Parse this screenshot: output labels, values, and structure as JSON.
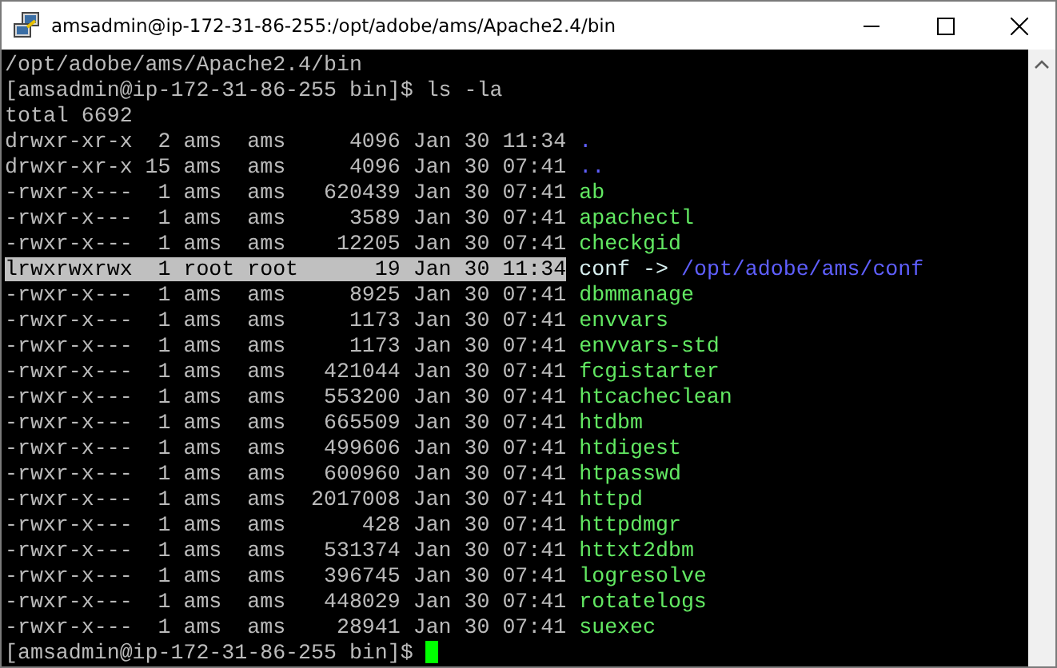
{
  "window": {
    "title": "amsadmin@ip-172-31-86-255:/opt/adobe/ams/Apache2.4/bin"
  },
  "terminal": {
    "lines": [
      {
        "kind": "text",
        "text": "/opt/adobe/ams/Apache2.4/bin"
      },
      {
        "kind": "text",
        "text": "[amsadmin@ip-172-31-86-255 bin]$ ls -la"
      },
      {
        "kind": "text",
        "text": "total 6692"
      },
      {
        "kind": "entry",
        "color": "#5f5fff",
        "selected": false,
        "info": "drwxr-xr-x  2 ams  ams     4096 Jan 30 11:34",
        "name": "."
      },
      {
        "kind": "entry",
        "color": "#5f5fff",
        "selected": false,
        "info": "drwxr-xr-x 15 ams  ams     4096 Jan 30 07:41",
        "name": ".."
      },
      {
        "kind": "entry",
        "color": "#62e862",
        "selected": false,
        "info": "-rwxr-x---  1 ams  ams   620439 Jan 30 07:41",
        "name": "ab"
      },
      {
        "kind": "entry",
        "color": "#62e862",
        "selected": false,
        "info": "-rwxr-x---  1 ams  ams     3589 Jan 30 07:41",
        "name": "apachectl"
      },
      {
        "kind": "entry",
        "color": "#62e862",
        "selected": false,
        "info": "-rwxr-x---  1 ams  ams    12205 Jan 30 07:41",
        "name": "checkgid"
      },
      {
        "kind": "entry",
        "color": "#d8f0f0",
        "selected": true,
        "info": "lrwxrwxrwx  1 root root      19 Jan 30 11:34",
        "name": "conf",
        "arrow": "->",
        "target": "/opt/adobe/ams/conf"
      },
      {
        "kind": "entry",
        "color": "#62e862",
        "selected": false,
        "info": "-rwxr-x---  1 ams  ams     8925 Jan 30 07:41",
        "name": "dbmmanage"
      },
      {
        "kind": "entry",
        "color": "#62e862",
        "selected": false,
        "info": "-rwxr-x---  1 ams  ams     1173 Jan 30 07:41",
        "name": "envvars"
      },
      {
        "kind": "entry",
        "color": "#62e862",
        "selected": false,
        "info": "-rwxr-x---  1 ams  ams     1173 Jan 30 07:41",
        "name": "envvars-std"
      },
      {
        "kind": "entry",
        "color": "#62e862",
        "selected": false,
        "info": "-rwxr-x---  1 ams  ams   421044 Jan 30 07:41",
        "name": "fcgistarter"
      },
      {
        "kind": "entry",
        "color": "#62e862",
        "selected": false,
        "info": "-rwxr-x---  1 ams  ams   553200 Jan 30 07:41",
        "name": "htcacheclean"
      },
      {
        "kind": "entry",
        "color": "#62e862",
        "selected": false,
        "info": "-rwxr-x---  1 ams  ams   665509 Jan 30 07:41",
        "name": "htdbm"
      },
      {
        "kind": "entry",
        "color": "#62e862",
        "selected": false,
        "info": "-rwxr-x---  1 ams  ams   499606 Jan 30 07:41",
        "name": "htdigest"
      },
      {
        "kind": "entry",
        "color": "#62e862",
        "selected": false,
        "info": "-rwxr-x---  1 ams  ams   600960 Jan 30 07:41",
        "name": "htpasswd"
      },
      {
        "kind": "entry",
        "color": "#62e862",
        "selected": false,
        "info": "-rwxr-x---  1 ams  ams  2017008 Jan 30 07:41",
        "name": "httpd"
      },
      {
        "kind": "entry",
        "color": "#62e862",
        "selected": false,
        "info": "-rwxr-x---  1 ams  ams      428 Jan 30 07:41",
        "name": "httpdmgr"
      },
      {
        "kind": "entry",
        "color": "#62e862",
        "selected": false,
        "info": "-rwxr-x---  1 ams  ams   531374 Jan 30 07:41",
        "name": "httxt2dbm"
      },
      {
        "kind": "entry",
        "color": "#62e862",
        "selected": false,
        "info": "-rwxr-x---  1 ams  ams   396745 Jan 30 07:41",
        "name": "logresolve"
      },
      {
        "kind": "entry",
        "color": "#62e862",
        "selected": false,
        "info": "-rwxr-x---  1 ams  ams   448029 Jan 30 07:41",
        "name": "rotatelogs"
      },
      {
        "kind": "entry",
        "color": "#62e862",
        "selected": false,
        "info": "-rwxr-x---  1 ams  ams    28941 Jan 30 07:41",
        "name": "suexec"
      },
      {
        "kind": "prompt",
        "text": "[amsadmin@ip-172-31-86-255 bin]$",
        "cursor": true
      }
    ]
  }
}
